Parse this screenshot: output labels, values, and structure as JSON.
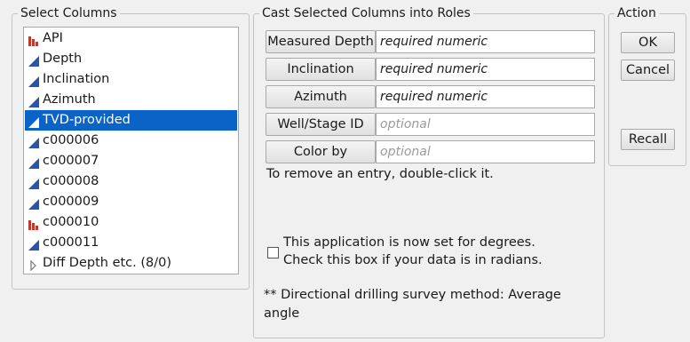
{
  "select_columns": {
    "title": "Select Columns",
    "items": [
      {
        "label": "API",
        "icon": "nominal-bar-icon",
        "selected": false
      },
      {
        "label": "Depth",
        "icon": "continuous-triangle-icon",
        "selected": false
      },
      {
        "label": "Inclination",
        "icon": "continuous-triangle-icon",
        "selected": false
      },
      {
        "label": "Azimuth",
        "icon": "continuous-triangle-icon",
        "selected": false
      },
      {
        "label": "TVD-provided",
        "icon": "continuous-triangle-icon",
        "selected": true
      },
      {
        "label": "c000006",
        "icon": "continuous-triangle-icon",
        "selected": false
      },
      {
        "label": "c000007",
        "icon": "continuous-triangle-icon",
        "selected": false
      },
      {
        "label": "c000008",
        "icon": "continuous-triangle-icon",
        "selected": false
      },
      {
        "label": "c000009",
        "icon": "continuous-triangle-icon",
        "selected": false
      },
      {
        "label": "c000010",
        "icon": "nominal-bar-icon",
        "selected": false
      },
      {
        "label": "c000011",
        "icon": "continuous-triangle-icon",
        "selected": false
      },
      {
        "label": "Diff Depth etc. (8/0)",
        "icon": "expand-triangle-icon",
        "selected": false
      }
    ]
  },
  "cast_roles": {
    "title": "Cast Selected Columns into Roles",
    "roles": [
      {
        "button": "Measured Depth",
        "placeholder": "required numeric",
        "required": true
      },
      {
        "button": "Inclination",
        "placeholder": "required numeric",
        "required": true
      },
      {
        "button": "Azimuth",
        "placeholder": "required numeric",
        "required": true
      },
      {
        "button": "Well/Stage ID",
        "placeholder": "optional",
        "required": false
      },
      {
        "button": "Color by",
        "placeholder": "optional",
        "required": false
      }
    ],
    "hint": "To remove an entry, double-click it.",
    "radians_checkbox": {
      "line1": "This application is now set for degrees.",
      "line2": "Check this box if your data is in radians.",
      "checked": false
    },
    "note": "** Directional drilling survey method: Average angle"
  },
  "action": {
    "title": "Action",
    "ok": "OK",
    "cancel": "Cancel",
    "recall": "Recall"
  },
  "colors": {
    "selection": "#0a64c8",
    "continuous_icon": "#2a54a8",
    "nominal_icon": "#c0392b"
  }
}
